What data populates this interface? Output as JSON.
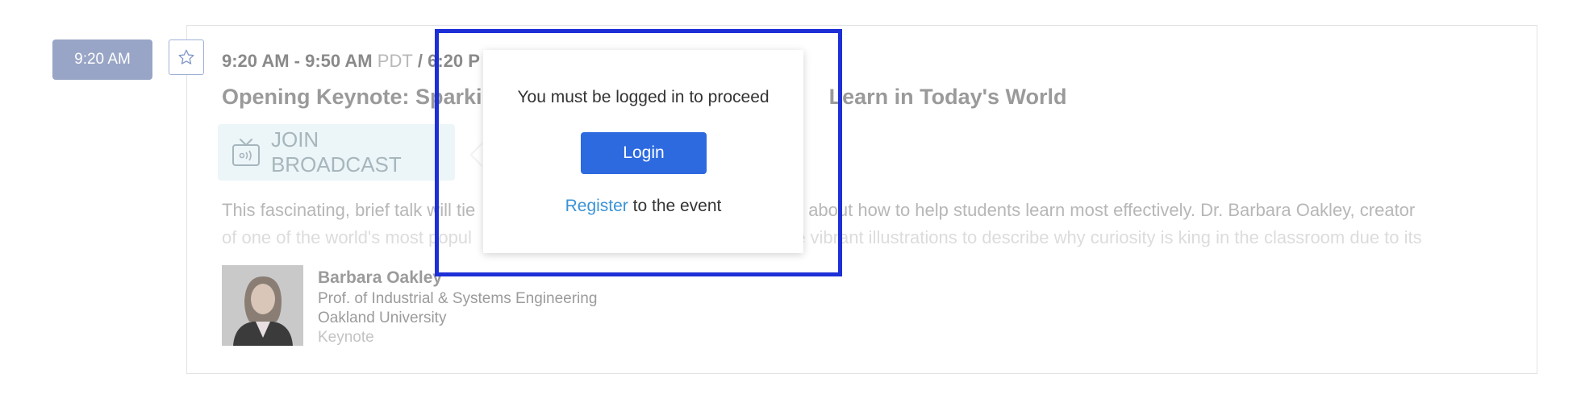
{
  "time_badge": "9:20 AM",
  "session": {
    "time_range": "9:20 AM - 9:50 AM",
    "tz_primary": "PDT",
    "separator": " / ",
    "time_secondary": "6:20 P",
    "title": "Opening Keynote: Sparking",
    "title_end": "Learn in Today's World",
    "broadcast_label": "JOIN BROADCAST",
    "description_line1_a": "This fascinating, brief talk will tie",
    "description_line1_b": "science about how to help students learn most effectively.  Dr. Barbara Oakley, creator",
    "description_line2_a": "of one of the world's most popul",
    "description_line2_b": "se vibrant illustrations to describe why curiosity is king in the classroom due to its"
  },
  "speaker": {
    "name": "Barbara Oakley",
    "title": "Prof. of Industrial & Systems Engineering",
    "organization": "Oakland University",
    "role": "Keynote"
  },
  "popover": {
    "message": "You must be logged in to proceed",
    "login_label": "Login",
    "register_link": "Register",
    "register_suffix": " to the event"
  },
  "icons": {
    "favorite": "star-outline-icon",
    "broadcast": "tv-broadcast-icon"
  },
  "colors": {
    "badge": "#98a5c6",
    "login_button": "#2d6ae0",
    "register_link": "#3a93d6",
    "highlight": "#1d2fd6"
  }
}
